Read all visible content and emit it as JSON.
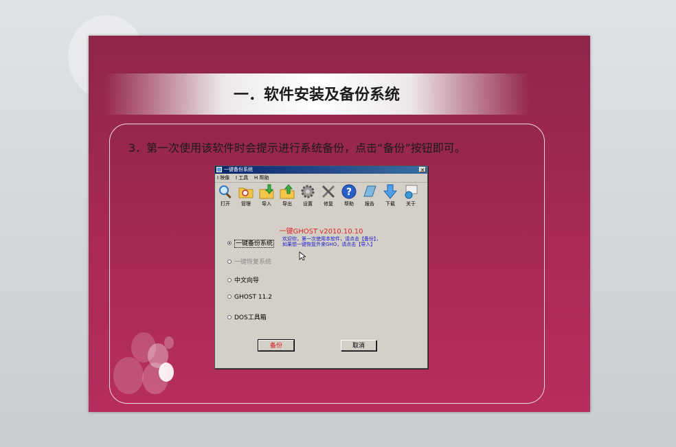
{
  "slide": {
    "title": "一．软件安装及备份系统",
    "instruction": "3．第一次使用该软件时会提示进行系统备份，点击“备份”按钮即可。"
  },
  "app": {
    "window_title": "一键备份系统",
    "close_symbol": "✕",
    "menu": [
      "I 映像",
      "I 工具",
      "H 帮助"
    ],
    "toolbar": [
      {
        "label": "打开",
        "icon": "magnifier-icon"
      },
      {
        "label": "管理",
        "icon": "folder-search-icon"
      },
      {
        "label": "导入",
        "icon": "import-icon"
      },
      {
        "label": "导出",
        "icon": "export-icon"
      },
      {
        "label": "设置",
        "icon": "settings-gear-icon"
      },
      {
        "label": "修复",
        "icon": "repair-tools-icon"
      },
      {
        "label": "帮助",
        "icon": "help-icon"
      },
      {
        "label": "报告",
        "icon": "report-icon"
      },
      {
        "label": "下载",
        "icon": "download-icon"
      },
      {
        "label": "关于",
        "icon": "about-icon"
      }
    ],
    "version": "一键GHOST v2010.10.10",
    "options": [
      {
        "label": "一键备份系统",
        "selected": true,
        "disabled": false
      },
      {
        "label": "一键恢复系统",
        "selected": false,
        "disabled": true
      },
      {
        "label": "中文向导",
        "selected": false,
        "disabled": false
      },
      {
        "label": "GHOST 11.2",
        "selected": false,
        "disabled": false
      },
      {
        "label": "DOS工具箱",
        "selected": false,
        "disabled": false
      }
    ],
    "welcome_lines": [
      "欢迎你，第一次使用本软件，请点击【备份】，",
      "如果想一键恢复外来GHO，请点击【导入】"
    ],
    "buttons": {
      "backup": "备份",
      "cancel": "取消"
    }
  },
  "colors": {
    "slide_bg": "#a92a55",
    "version_red": "#e02020",
    "welcome_blue": "#1a1ad0",
    "window_face": "#d4d0c8"
  }
}
